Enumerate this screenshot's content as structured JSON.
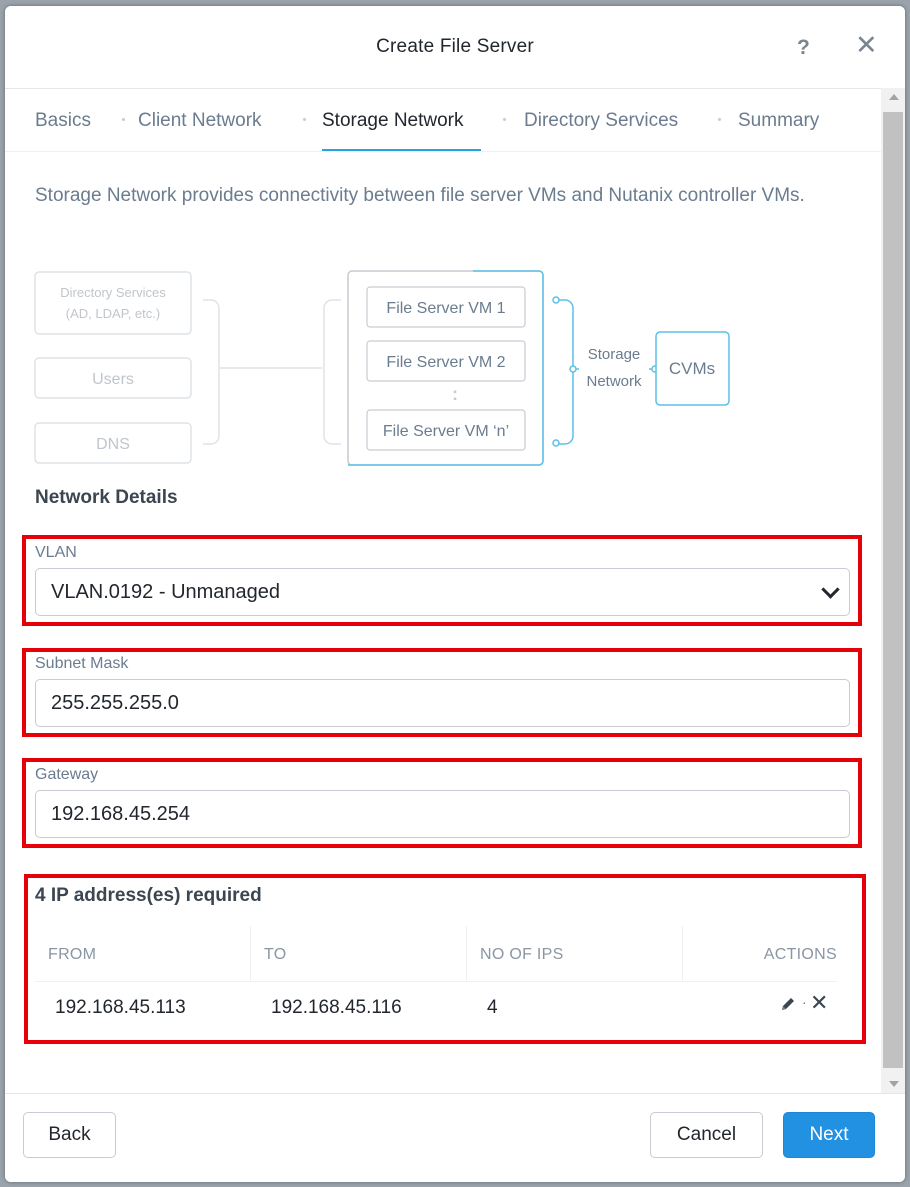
{
  "dialog": {
    "title": "Create File Server",
    "help_icon": "?",
    "close_icon": "✕"
  },
  "tabs": [
    {
      "label": "Basics",
      "active": false
    },
    {
      "label": "Client Network",
      "active": false
    },
    {
      "label": "Storage Network",
      "active": true
    },
    {
      "label": "Directory Services",
      "active": false
    },
    {
      "label": "Summary",
      "active": false
    }
  ],
  "description": "Storage Network provides connectivity between file server VMs and Nutanix controller VMs.",
  "diagram": {
    "directory_services": [
      "Directory Services",
      "(AD, LDAP, etc.)"
    ],
    "users": "Users",
    "dns": "DNS",
    "fsvm1": "File Server VM 1",
    "fsvm2": "File Server VM 2",
    "fsvm_n": "File Server VM ‘n’",
    "ellipsis": ":",
    "storage_network": [
      "Storage",
      "Network"
    ],
    "cvms": "CVMs",
    "accent_color": "#5bc0e8"
  },
  "network_details": {
    "title": "Network Details",
    "vlan": {
      "label": "VLAN",
      "value": "VLAN.0192 - Unmanaged"
    },
    "subnet_mask": {
      "label": "Subnet Mask",
      "value": "255.255.255.0"
    },
    "gateway": {
      "label": "Gateway",
      "value": "192.168.45.254"
    }
  },
  "ip_table": {
    "required_text": "4 IP address(es) required",
    "columns": [
      "FROM",
      "TO",
      "NO OF IPS",
      "ACTIONS"
    ],
    "rows": [
      {
        "from": "192.168.45.113",
        "to": "192.168.45.116",
        "count": "4"
      }
    ],
    "action_separator": "·",
    "delete_glyph": "✕"
  },
  "footer": {
    "back": "Back",
    "cancel": "Cancel",
    "next": "Next"
  },
  "colors": {
    "highlight": "#e6000a",
    "primary_button": "#2291e2",
    "active_tab": "#26a2e0"
  }
}
